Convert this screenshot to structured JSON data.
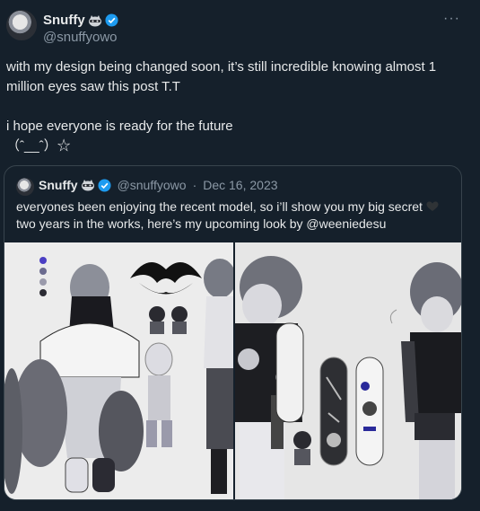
{
  "tweet": {
    "display_name": "Snuffy",
    "handle": "@snuffyowo",
    "text": "with my design being changed soon, it’s still incredible knowing almost 1 million eyes saw this post T.T\n\ni hope everyone is ready for the future\n（ˆ__ˆ）☆",
    "more_label": "···"
  },
  "quote": {
    "display_name": "Snuffy",
    "handle": "@snuffyowo",
    "separator": "·",
    "date": "Dec 16, 2023",
    "text": "everyones been enjoying the recent model, so i’ll show you my big secret ",
    "text2": "two years in the works, here’s my upcoming look by @weeniedesu"
  },
  "colors": {
    "background": "#15202b",
    "text": "#e7e9ea",
    "muted": "#8b98a5",
    "verified": "#1d9bf0",
    "border": "#38444d"
  },
  "icons": [
    "raccoon-icon",
    "verified-icon",
    "more-icon",
    "heart-icon"
  ]
}
